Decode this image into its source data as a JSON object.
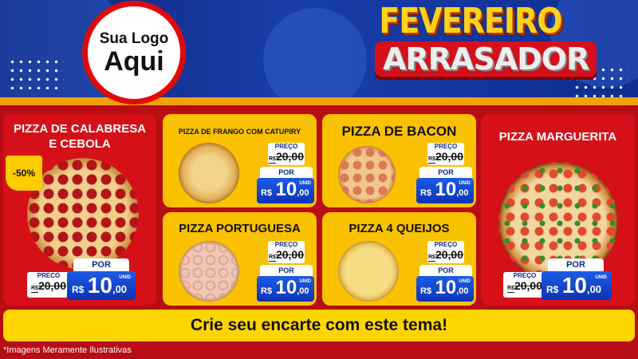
{
  "header": {
    "logo_line1": "Sua Logo",
    "logo_line2": "Aqui",
    "title_line1": "FEVEREIRO",
    "title_line2": "ARRASADOR"
  },
  "products": [
    {
      "name": "PIZZA DE CALABRESA E CEBOLA",
      "badge": "-50%",
      "preco_label": "PRECO",
      "old_price_prefix": "R$",
      "old_price": "20,00",
      "por_label": "POR",
      "currency": "R$",
      "price_int": "10",
      "price_dec": ",00",
      "unit": "UNID"
    },
    {
      "name": "PIZZA DE FRANGO COM CATUPIRY",
      "preco_label": "PREÇO",
      "old_price_prefix": "R$",
      "old_price": "20,00",
      "por_label": "POR",
      "currency": "R$",
      "price_int": "10",
      "price_dec": ",00",
      "unit": "UNID"
    },
    {
      "name": "PIZZA DE BACON",
      "preco_label": "PREÇO",
      "old_price_prefix": "R$",
      "old_price": "20,00",
      "por_label": "POR",
      "currency": "R$",
      "price_int": "10",
      "price_dec": ",00",
      "unit": "UNID"
    },
    {
      "name": "PIZZA MARGUERITA",
      "preco_label": "PREÇO",
      "old_price_prefix": "R$",
      "old_price": "20,00",
      "por_label": "POR",
      "currency": "R$",
      "price_int": "10",
      "price_dec": ",00",
      "unit": "UNID"
    },
    {
      "name": "PIZZA PORTUGUESA",
      "preco_label": "PREÇO",
      "old_price_prefix": "R$",
      "old_price": "20,00",
      "por_label": "POR",
      "currency": "R$",
      "price_int": "10",
      "price_dec": ",00",
      "unit": "UNID"
    },
    {
      "name": "PIZZA 4 QUEIJOS",
      "preco_label": "PREÇO",
      "old_price_prefix": "R$",
      "old_price": "20,00",
      "por_label": "POR",
      "currency": "R$",
      "price_int": "10",
      "price_dec": ",00",
      "unit": "UNID"
    }
  ],
  "footer": {
    "banner": "Crie seu encarte com este tema!",
    "disclaimer": "*Imagens Meramente Ilustrativas"
  },
  "colors": {
    "background_blue": "#0b2a8a",
    "card_red": "#d61018",
    "card_yellow": "#f9c100",
    "price_blue": "#1e5be6",
    "logo_ring": "#e10a0a"
  },
  "icons": [
    "pizza-calabresa-image",
    "pizza-frango-image",
    "pizza-bacon-image",
    "pizza-marguerita-image",
    "pizza-portuguesa-image",
    "pizza-4-queijos-image"
  ]
}
